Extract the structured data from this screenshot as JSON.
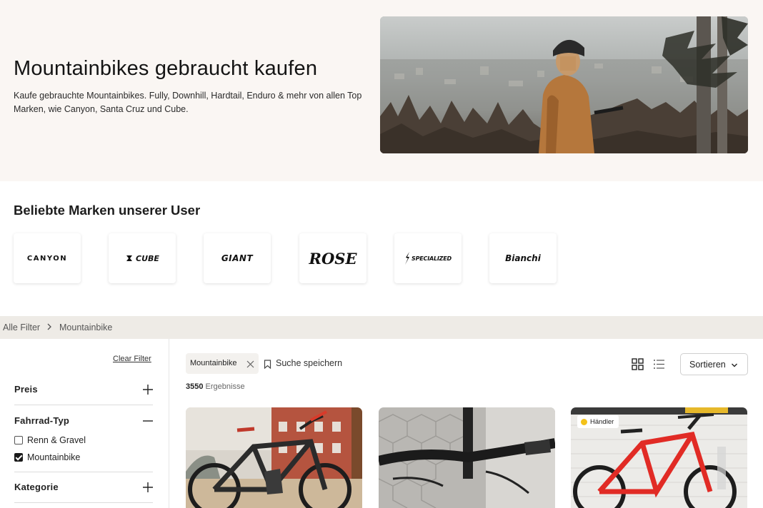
{
  "hero": {
    "title": "Mountainbikes gebraucht kaufen",
    "subtitle": "Kaufe gebrauchte Mountainbikes. Fully, Downhill, Hardtail, Enduro & mehr von allen Top Marken, wie Canyon, Santa Cruz und Cube."
  },
  "brands": {
    "title": "Beliebte Marken unserer User",
    "items": [
      {
        "name": "CANYON",
        "icon": "canyon-logo"
      },
      {
        "name": "CUBE",
        "icon": "cube-logo"
      },
      {
        "name": "GIANT",
        "icon": "giant-logo"
      },
      {
        "name": "ROSE",
        "icon": "rose-logo"
      },
      {
        "name": "SPECIALIZED",
        "icon": "specialized-logo"
      },
      {
        "name": "Bianchi",
        "icon": "bianchi-logo"
      }
    ]
  },
  "breadcrumb": {
    "items": [
      "Alle Filter",
      "Mountainbike"
    ]
  },
  "sidebar": {
    "clear_filter": "Clear Filter",
    "filters": [
      {
        "label": "Preis",
        "expanded": false
      },
      {
        "label": "Fahrrad-Typ",
        "expanded": true,
        "options": [
          {
            "label": "Renn & Gravel",
            "checked": false
          },
          {
            "label": "Mountainbike",
            "checked": true
          }
        ]
      },
      {
        "label": "Kategorie",
        "expanded": false
      }
    ]
  },
  "toolbar": {
    "active_chip": "Mountainbike",
    "save_search": "Suche speichern",
    "results_count": "3550",
    "results_label": "Ergebnisse",
    "sort_label": "Sortieren"
  },
  "products": [
    {
      "badge": ""
    },
    {
      "badge": ""
    },
    {
      "badge": "Händler"
    }
  ],
  "colors": {
    "hero_bg": "#faf6f3",
    "crumb_bg": "#eeebe6",
    "badge_yellow": "#f3c21a"
  }
}
